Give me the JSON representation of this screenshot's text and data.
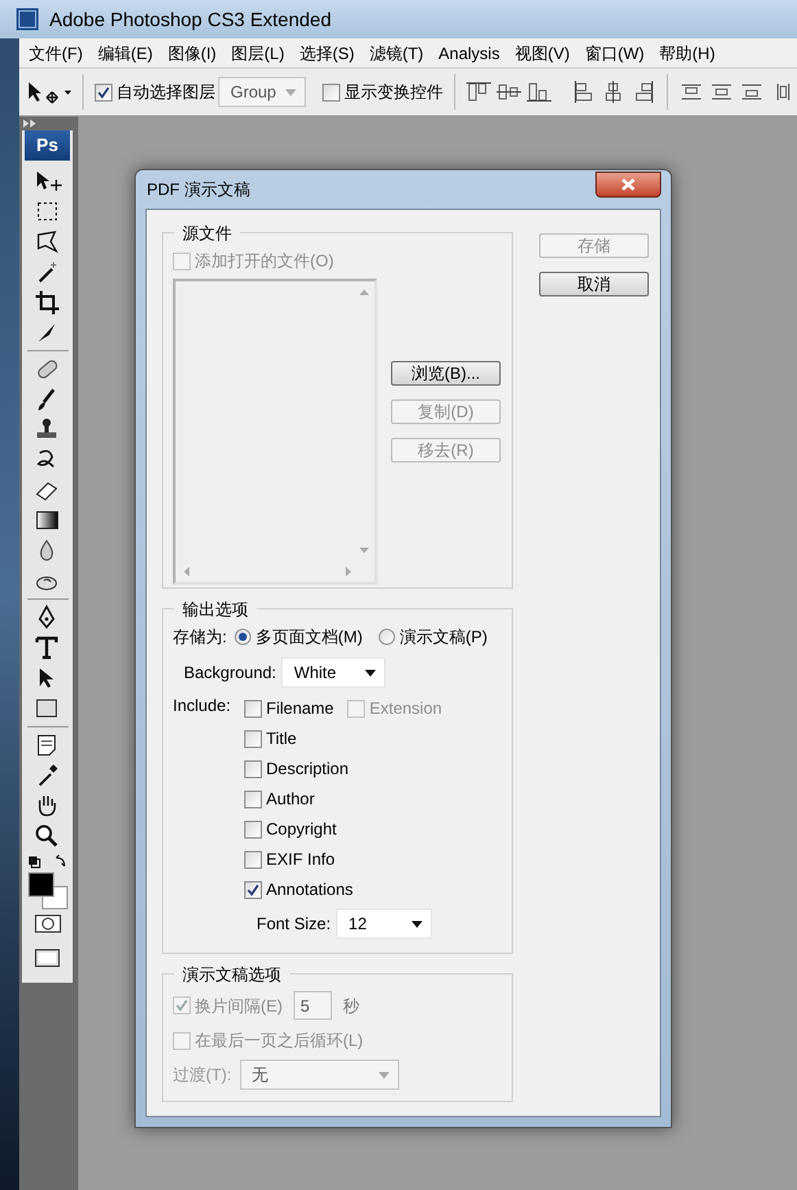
{
  "window": {
    "title": "Adobe Photoshop CS3 Extended"
  },
  "menu_bar": [
    {
      "label": "文件(F)"
    },
    {
      "label": "编辑(E)"
    },
    {
      "label": "图像(I)"
    },
    {
      "label": "图层(L)"
    },
    {
      "label": "选择(S)"
    },
    {
      "label": "滤镜(T)"
    },
    {
      "label": "Analysis"
    },
    {
      "label": "视图(V)"
    },
    {
      "label": "窗口(W)"
    },
    {
      "label": "帮助(H)"
    }
  ],
  "options_bar": {
    "auto_select": {
      "label": "自动选择图层",
      "checked": true
    },
    "group_dropdown": {
      "value": "Group",
      "disabled": true
    },
    "show_transform": {
      "label": "显示变换控件",
      "checked": false
    }
  },
  "toolbox": {
    "logo": "Ps"
  },
  "dialog": {
    "title": "PDF 演示文稿",
    "buttons": [
      {
        "label": "存储",
        "disabled": true
      },
      {
        "label": "取消",
        "disabled": false
      }
    ],
    "source_files": {
      "legend": "源文件",
      "add_open_files": {
        "label": "添加打开的文件(O)",
        "checked": false,
        "disabled": true
      },
      "buttons": [
        {
          "label": "浏览(B)...",
          "disabled": false
        },
        {
          "label": "复制(D)",
          "disabled": true
        },
        {
          "label": "移去(R)",
          "disabled": true
        }
      ]
    },
    "output_options": {
      "legend": "输出选项",
      "save_as_label": "存储为:",
      "save_as": [
        {
          "label": "多页面文档(M)",
          "selected": true
        },
        {
          "label": "演示文稿(P)",
          "selected": false
        }
      ],
      "background": {
        "label": "Background:",
        "value": "White"
      },
      "include_label": "Include:",
      "include_rows": [
        {
          "items": [
            {
              "label": "Filename",
              "checked": false,
              "disabled": false
            },
            {
              "label": "Extension",
              "checked": false,
              "disabled": true
            }
          ]
        },
        {
          "items": [
            {
              "label": "Title",
              "checked": false,
              "disabled": false
            }
          ]
        },
        {
          "items": [
            {
              "label": "Description",
              "checked": false,
              "disabled": false
            }
          ]
        },
        {
          "items": [
            {
              "label": "Author",
              "checked": false,
              "disabled": false
            }
          ]
        },
        {
          "items": [
            {
              "label": "Copyright",
              "checked": false,
              "disabled": false
            }
          ]
        },
        {
          "items": [
            {
              "label": "EXIF Info",
              "checked": false,
              "disabled": false
            }
          ]
        },
        {
          "items": [
            {
              "label": "Annotations",
              "checked": true,
              "disabled": false
            }
          ]
        }
      ],
      "font_size": {
        "label": "Font Size:",
        "value": "12"
      }
    },
    "presentation_options": {
      "legend": "演示文稿选项",
      "advance": {
        "label": "换片间隔(E)",
        "checked": true,
        "disabled": true,
        "value": "5",
        "unit": "秒"
      },
      "loop": {
        "label": "在最后一页之后循环(L)",
        "checked": false,
        "disabled": true
      },
      "transition": {
        "label": "过渡(T):",
        "value": "无",
        "disabled": true
      }
    }
  }
}
